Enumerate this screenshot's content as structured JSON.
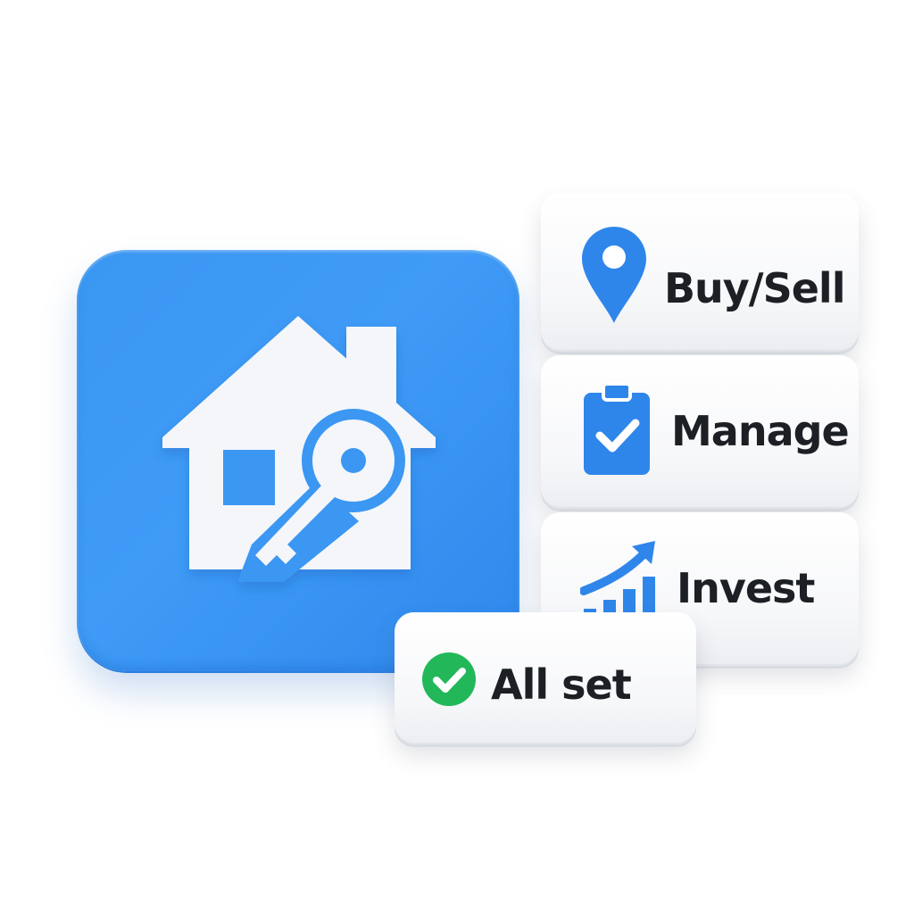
{
  "app_tile": {
    "icon": "house-key-icon",
    "color": "#3a97f2"
  },
  "cards": {
    "buy_sell": {
      "label": "Buy/Sell",
      "icon": "location-pin-icon",
      "icon_color": "#2f86ea"
    },
    "manage": {
      "label": "Manage",
      "icon": "clipboard-check-icon",
      "icon_color": "#2f86ea"
    },
    "invest": {
      "label": "Invest",
      "icon": "growth-chart-icon",
      "icon_color": "#2f86ea"
    },
    "all_set": {
      "label": "All set",
      "icon": "green-check-icon",
      "icon_color": "#22b85a"
    }
  }
}
